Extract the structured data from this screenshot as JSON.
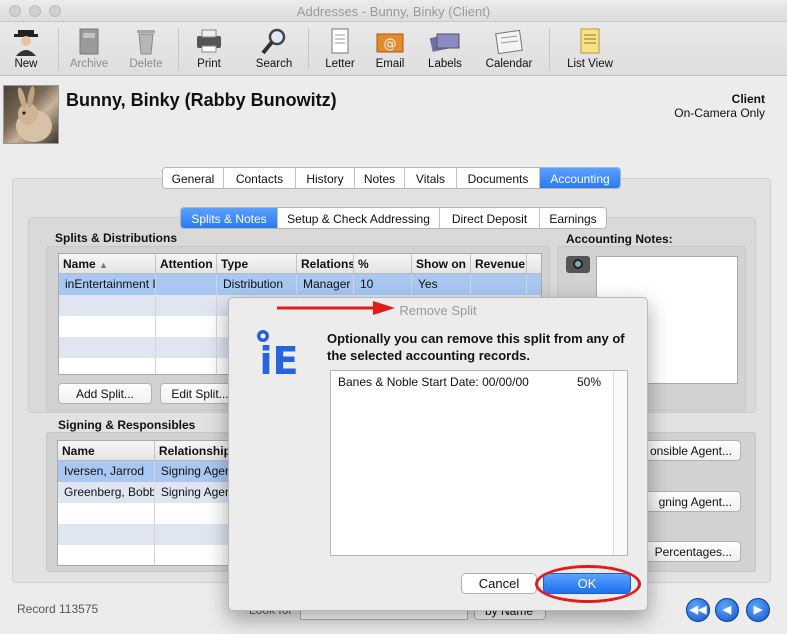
{
  "window": {
    "title": "Addresses - Bunny, Binky (Client)"
  },
  "toolbar": {
    "items": [
      {
        "label": "New",
        "icon": "spy-person-icon",
        "enabled": true
      },
      {
        "label": "Archive",
        "icon": "archive-box-icon",
        "enabled": false
      },
      {
        "label": "Delete",
        "icon": "trash-can-icon",
        "enabled": false
      },
      {
        "label": "Print",
        "icon": "printer-icon",
        "enabled": true
      },
      {
        "label": "Search",
        "icon": "magnifier-icon",
        "enabled": true
      },
      {
        "label": "Letter",
        "icon": "letter-icon",
        "enabled": true
      },
      {
        "label": "Email",
        "icon": "email-icon",
        "enabled": true
      },
      {
        "label": "Labels",
        "icon": "labels-icon",
        "enabled": true
      },
      {
        "label": "Calendar",
        "icon": "calendar-icon",
        "enabled": true
      },
      {
        "label": "List View",
        "icon": "list-view-icon",
        "enabled": true
      }
    ]
  },
  "header": {
    "name": "Bunny, Binky (Rabby Bunowitz)",
    "type": "Client",
    "subtype": "On-Camera Only"
  },
  "tabs": [
    "General",
    "Contacts",
    "History",
    "Notes",
    "Vitals",
    "Documents",
    "Accounting"
  ],
  "active_tab": "Accounting",
  "subtabs": [
    "Splits & Notes",
    "Setup & Check Addressing",
    "Direct Deposit",
    "Earnings"
  ],
  "active_subtab": "Splits & Notes",
  "splits": {
    "title": "Splits & Distributions",
    "columns": [
      "Name",
      "Attention",
      "Type",
      "Relations",
      "%",
      "Show on",
      "Revenue"
    ],
    "rows": [
      {
        "name": "inEntertainment I",
        "attention": "",
        "type": "Distribution",
        "relation": "Manager",
        "pct": "10",
        "show_on": "Yes",
        "revenue": ""
      }
    ],
    "add_button": "Add Split...",
    "edit_button": "Edit Split..."
  },
  "accounting_notes": {
    "title": "Accounting Notes:"
  },
  "signing": {
    "title": "Signing & Responsibles",
    "columns": [
      "Name",
      "Relationship"
    ],
    "rows": [
      {
        "name": "Iversen, Jarrod",
        "relationship": "Signing Ager"
      },
      {
        "name": "Greenberg, Bobb",
        "relationship": "Signing Ager"
      }
    ],
    "buttons": [
      "onsible Agent...",
      "gning Agent...",
      "Percentages..."
    ]
  },
  "footer": {
    "record": "Record 113575",
    "look_for": "Look for",
    "by_name": "by Name"
  },
  "dialog": {
    "title": "Remove Split",
    "message": "Optionally you can remove this split from any of the selected accounting records.",
    "list": [
      {
        "text": "Banes & Noble Start Date: 00/00/00",
        "pct": "50%"
      }
    ],
    "cancel": "Cancel",
    "ok": "OK",
    "logo_text": "iE"
  },
  "colors": {
    "accent": "#2a7af0",
    "annotation_red": "#e31b1b",
    "selected_row": "#a8c8f2"
  }
}
